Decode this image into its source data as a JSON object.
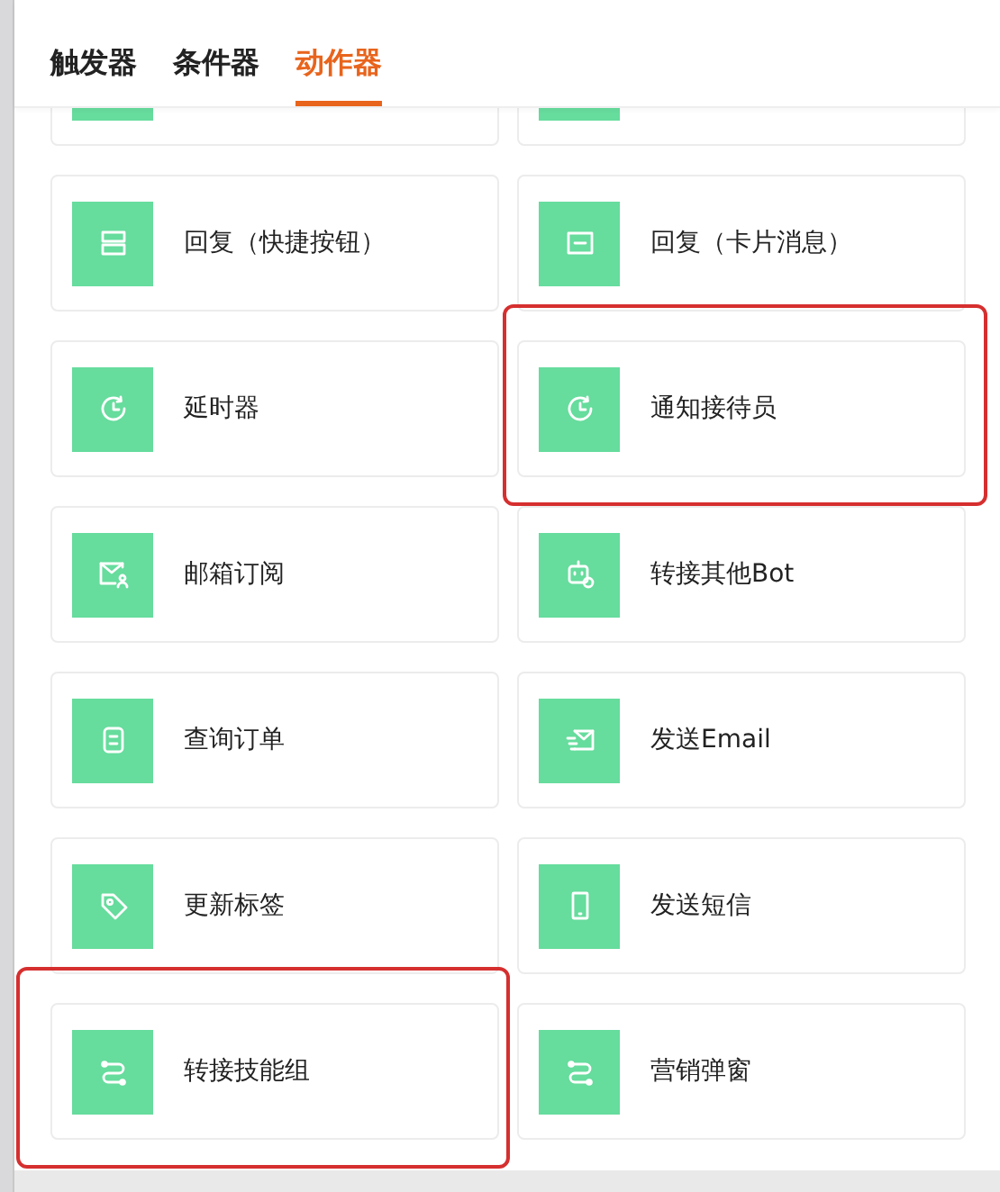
{
  "tabs": [
    {
      "label": "触发器",
      "selected": false
    },
    {
      "label": "条件器",
      "selected": false
    },
    {
      "label": "动作器",
      "selected": true
    }
  ],
  "actions": [
    {
      "kind": "blank",
      "highlighted": false
    },
    {
      "kind": "blank",
      "highlighted": false
    },
    {
      "kind": "buttons",
      "label": "回复（快捷按钮）",
      "highlighted": false
    },
    {
      "kind": "card",
      "label": "回复（卡片消息）",
      "highlighted": false
    },
    {
      "kind": "clock",
      "label": "延时器",
      "highlighted": false
    },
    {
      "kind": "clock",
      "label": "通知接待员",
      "highlighted": true
    },
    {
      "kind": "mail",
      "label": "邮箱订阅",
      "highlighted": false
    },
    {
      "kind": "robot",
      "label": "转接其他Bot",
      "highlighted": false
    },
    {
      "kind": "document",
      "label": "查询订单",
      "highlighted": false
    },
    {
      "kind": "send",
      "label": "发送Email",
      "highlighted": false
    },
    {
      "kind": "tag",
      "label": "更新标签",
      "highlighted": false
    },
    {
      "kind": "phone",
      "label": "发送短信",
      "highlighted": false
    },
    {
      "kind": "switch",
      "label": "转接技能组",
      "highlighted": true
    },
    {
      "kind": "switch",
      "label": "营销弹窗",
      "highlighted": false
    }
  ]
}
